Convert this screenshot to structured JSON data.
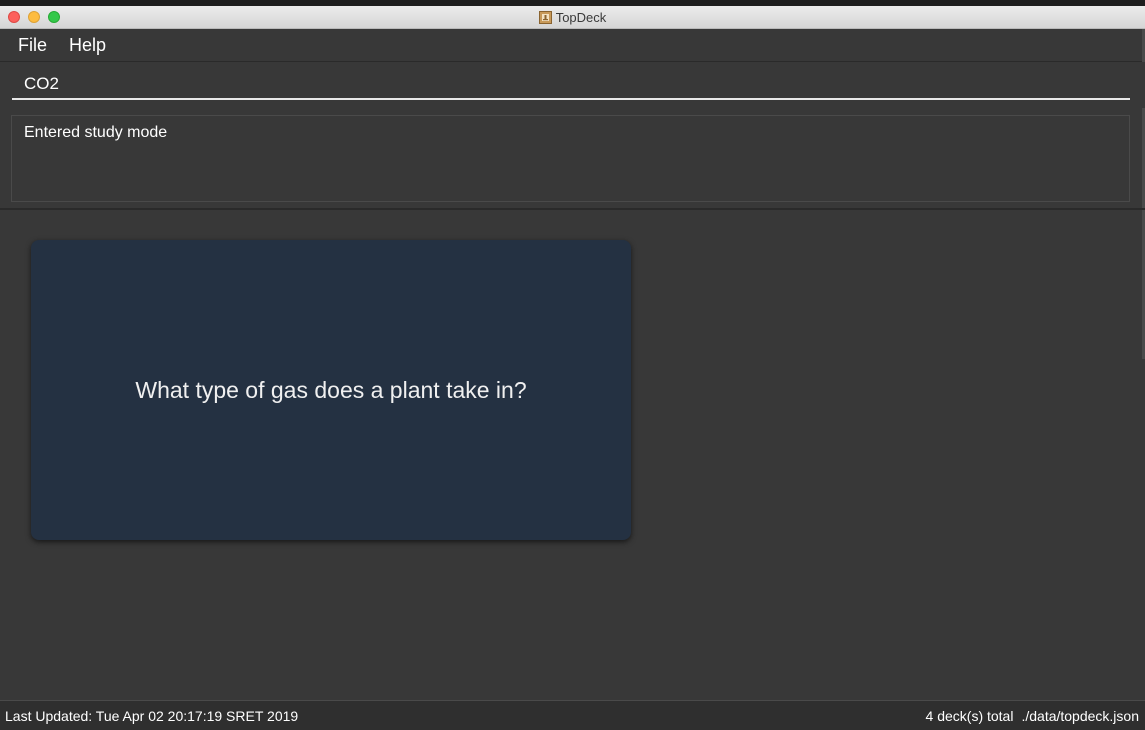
{
  "window": {
    "title": "TopDeck",
    "icon": "app-icon"
  },
  "menu": {
    "items": [
      {
        "label": "File"
      },
      {
        "label": "Help"
      }
    ]
  },
  "command": {
    "value": "CO2",
    "placeholder": ""
  },
  "result": {
    "message": "Entered study mode"
  },
  "card": {
    "question": "What type of gas does a plant take in?"
  },
  "status": {
    "last_updated": "Last Updated: Tue Apr 02 20:17:19 SRET 2019",
    "deck_count": "4 deck(s) total",
    "file_path": "./data/topdeck.json"
  },
  "colors": {
    "background": "#383838",
    "card": "#243142",
    "text": "#ffffff"
  }
}
